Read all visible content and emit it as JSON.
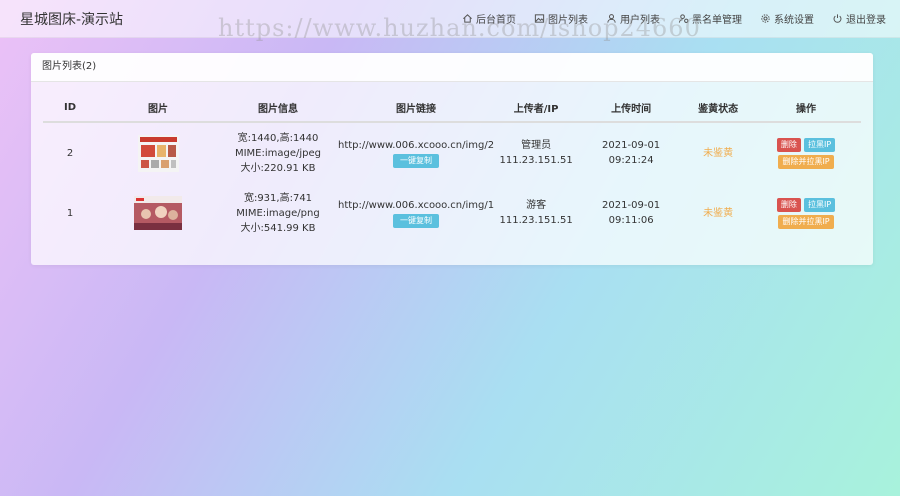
{
  "app": {
    "title": "星城图床-演示站"
  },
  "watermark": "https://www.huzhan.com/ishop24660",
  "nav": [
    {
      "label": "后台首页",
      "icon": "home-icon"
    },
    {
      "label": "图片列表",
      "icon": "image-icon"
    },
    {
      "label": "用户列表",
      "icon": "user-icon"
    },
    {
      "label": "黑名单管理",
      "icon": "user-block-icon"
    },
    {
      "label": "系统设置",
      "icon": "gear-icon"
    },
    {
      "label": "退出登录",
      "icon": "power-icon"
    }
  ],
  "panel": {
    "title": "图片列表(2)"
  },
  "table": {
    "headers": [
      "ID",
      "图片",
      "图片信息",
      "图片链接",
      "上传者/IP",
      "上传时间",
      "鉴黄状态",
      "操作"
    ],
    "copy_label": "一键复制",
    "actions": {
      "delete": "删除",
      "block_ip": "拉黑IP",
      "delete_block": "删除并拉黑IP"
    },
    "rows": [
      {
        "id": "2",
        "info": {
          "size": "宽:1440,高:1440",
          "mime": "MIME:image/jpeg",
          "filesize": "大小:220.91 KB"
        },
        "url": "http://www.006.xcooo.cn/img/2",
        "uploader": "管理员",
        "ip": "111.23.151.51",
        "time": "2021-09-01 09:21:24",
        "status": "未鉴黄"
      },
      {
        "id": "1",
        "info": {
          "size": "宽:931,高:741",
          "mime": "MIME:image/png",
          "filesize": "大小:541.99 KB"
        },
        "url": "http://www.006.xcooo.cn/img/1",
        "uploader": "游客",
        "ip": "111.23.151.51",
        "time": "2021-09-01 09:11:06",
        "status": "未鉴黄"
      }
    ]
  },
  "colors": {
    "info": "#5bc0de",
    "danger": "#d9534f",
    "warning": "#f0ad4e"
  }
}
